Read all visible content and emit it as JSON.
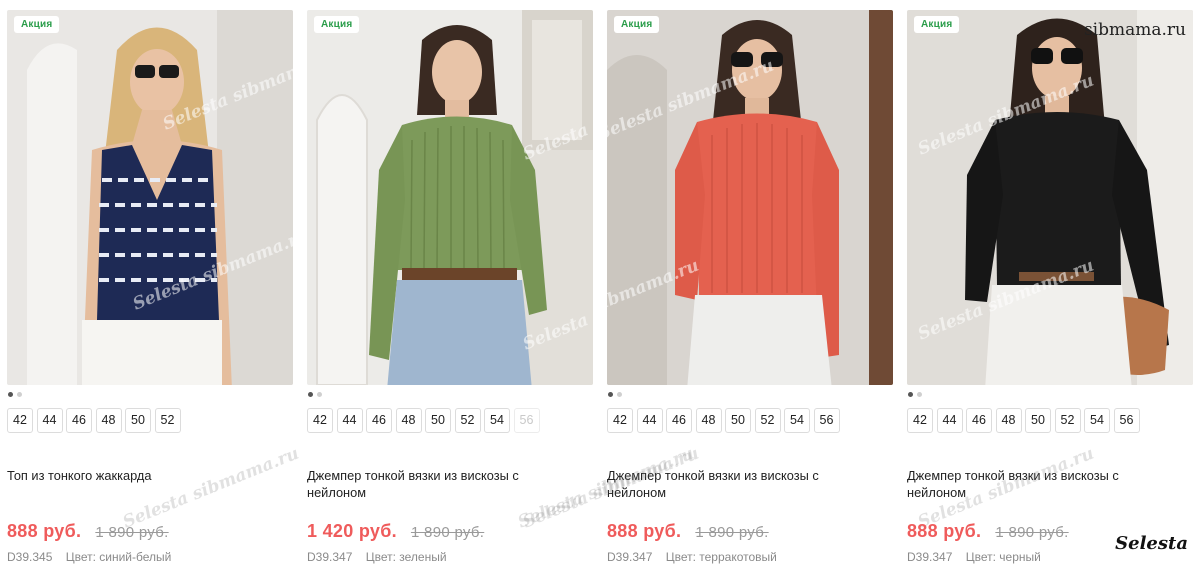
{
  "products": [
    {
      "badge": "Акция",
      "sizes": [
        "42",
        "44",
        "46",
        "48",
        "50",
        "52"
      ],
      "disabled_sizes": [],
      "title": "Топ из тонкого жаккарда",
      "price": "888 руб.",
      "old_price": "1 890 руб.",
      "sku": "D39.345",
      "color_label": "Цвет: синий-белый"
    },
    {
      "badge": "Акция",
      "sizes": [
        "42",
        "44",
        "46",
        "48",
        "50",
        "52",
        "54",
        "56"
      ],
      "disabled_sizes": [
        "56"
      ],
      "title": "Джемпер тонкой вязки из вискозы с нейлоном",
      "price": "1 420 руб.",
      "old_price": "1 890 руб.",
      "sku": "D39.347",
      "color_label": "Цвет: зеленый"
    },
    {
      "badge": "Акция",
      "sizes": [
        "42",
        "44",
        "46",
        "48",
        "50",
        "52",
        "54",
        "56"
      ],
      "disabled_sizes": [],
      "title": "Джемпер тонкой вязки из вискозы с нейлоном",
      "price": "888 руб.",
      "old_price": "1 890 руб.",
      "sku": "D39.347",
      "color_label": "Цвет: терракотовый"
    },
    {
      "badge": "Акция",
      "sizes": [
        "42",
        "44",
        "46",
        "48",
        "50",
        "52",
        "54",
        "56"
      ],
      "disabled_sizes": [],
      "title": "Джемпер тонкой вязки из вискозы с нейлоном",
      "price": "888 руб.",
      "old_price": "1 890 руб.",
      "sku": "D39.347",
      "color_label": "Цвет: черный"
    }
  ],
  "watermark_text": "Selesta sibmama.ru",
  "site_mark": "sibmama.ru",
  "brand_mark": "Selesta",
  "colors": {
    "badge_text": "#2a9d4a",
    "price": "#ef5b5b",
    "old_price": "#9a9a9a",
    "garments": [
      "#1e2a55",
      "#7d9a5a",
      "#e4614f",
      "#1b1b1b"
    ]
  }
}
